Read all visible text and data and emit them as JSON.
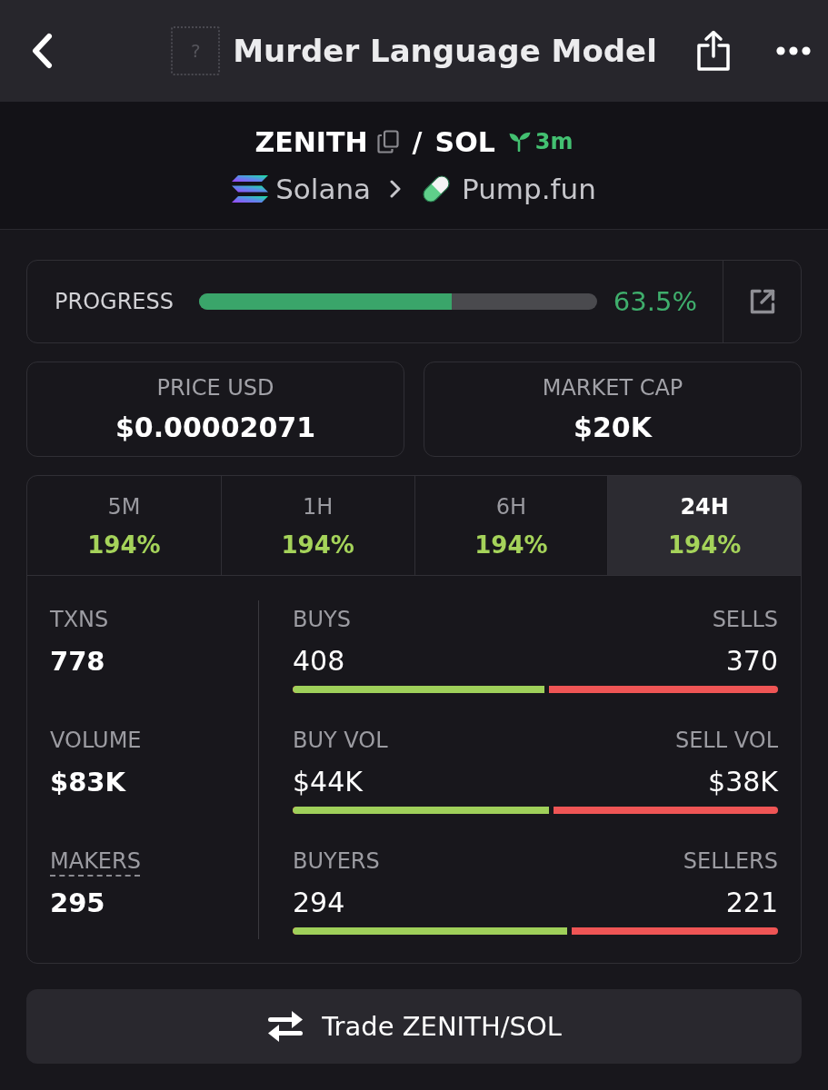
{
  "header": {
    "placeholder_glyph": "?",
    "title": "Murder Language Model"
  },
  "pair": {
    "base": "ZENITH",
    "separator": "/",
    "quote": "SOL",
    "age": "3m",
    "chain": "Solana",
    "dex": "Pump.fun"
  },
  "progress": {
    "label": "PROGRESS",
    "level": 0.635,
    "reading": "63.5%"
  },
  "price_cards": [
    {
      "label": "PRICE USD",
      "value": "$0.00002071"
    },
    {
      "label": "MARKET CAP",
      "value": "$20K"
    }
  ],
  "timeframes": [
    {
      "label": "5M",
      "change": "194%",
      "selected": false
    },
    {
      "label": "1H",
      "change": "194%",
      "selected": false
    },
    {
      "label": "6H",
      "change": "194%",
      "selected": false
    },
    {
      "label": "24H",
      "change": "194%",
      "selected": true
    }
  ],
  "stats": {
    "metrics": [
      {
        "label": "TXNS",
        "value": "778",
        "underlined": false
      },
      {
        "label": "VOLUME",
        "value": "$83K",
        "underlined": false
      },
      {
        "label": "MAKERS",
        "value": "295",
        "underlined": true
      }
    ],
    "splits": [
      {
        "buy_label": "BUYS",
        "buy_value": "408",
        "sell_label": "SELLS",
        "sell_value": "370",
        "level": 0.524
      },
      {
        "buy_label": "BUY VOL",
        "buy_value": "$44K",
        "sell_label": "SELL VOL",
        "sell_value": "$38K",
        "level": 0.533
      },
      {
        "buy_label": "BUYERS",
        "buy_value": "294",
        "sell_label": "SELLERS",
        "sell_value": "221",
        "level": 0.571
      }
    ]
  },
  "trade_button": {
    "label": "Trade ZENITH/SOL"
  }
}
